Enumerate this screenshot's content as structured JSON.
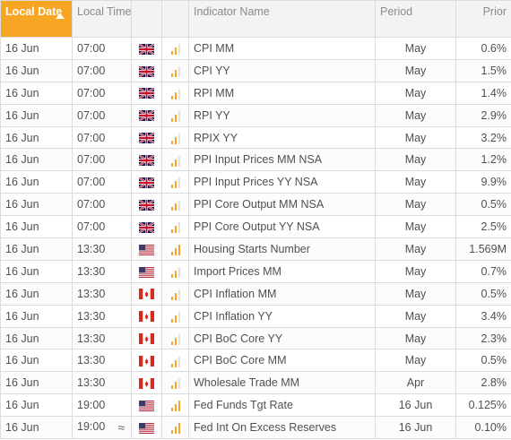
{
  "header": {
    "date_label": "Local Date",
    "time_label": "Local Time",
    "indicator_label": "Indicator Name",
    "period_label": "Period",
    "prior_label": "Prior"
  },
  "colors": {
    "accent": "#f7a623",
    "header_bg": "#f3f3f3",
    "border": "#dcdcdc"
  },
  "rows": [
    {
      "date": "16 Jun",
      "time": "07:00",
      "flag": "uk-flag-icon",
      "impact": "medium",
      "name": "CPI MM",
      "period": "May",
      "prior": "0.6%"
    },
    {
      "date": "16 Jun",
      "time": "07:00",
      "flag": "uk-flag-icon",
      "impact": "medium",
      "name": "CPI YY",
      "period": "May",
      "prior": "1.5%"
    },
    {
      "date": "16 Jun",
      "time": "07:00",
      "flag": "uk-flag-icon",
      "impact": "medium",
      "name": "RPI MM",
      "period": "May",
      "prior": "1.4%"
    },
    {
      "date": "16 Jun",
      "time": "07:00",
      "flag": "uk-flag-icon",
      "impact": "medium",
      "name": "RPI YY",
      "period": "May",
      "prior": "2.9%"
    },
    {
      "date": "16 Jun",
      "time": "07:00",
      "flag": "uk-flag-icon",
      "impact": "medium",
      "name": "RPIX YY",
      "period": "May",
      "prior": "3.2%"
    },
    {
      "date": "16 Jun",
      "time": "07:00",
      "flag": "uk-flag-icon",
      "impact": "medium",
      "name": "PPI Input Prices MM NSA",
      "period": "May",
      "prior": "1.2%"
    },
    {
      "date": "16 Jun",
      "time": "07:00",
      "flag": "uk-flag-icon",
      "impact": "medium",
      "name": "PPI Input Prices YY NSA",
      "period": "May",
      "prior": "9.9%"
    },
    {
      "date": "16 Jun",
      "time": "07:00",
      "flag": "uk-flag-icon",
      "impact": "medium",
      "name": "PPI Core Output MM NSA",
      "period": "May",
      "prior": "0.5%"
    },
    {
      "date": "16 Jun",
      "time": "07:00",
      "flag": "uk-flag-icon",
      "impact": "medium",
      "name": "PPI Core Output YY NSA",
      "period": "May",
      "prior": "2.5%"
    },
    {
      "date": "16 Jun",
      "time": "13:30",
      "flag": "us-flag-icon",
      "impact": "high",
      "name": "Housing Starts Number",
      "period": "May",
      "prior": "1.569M"
    },
    {
      "date": "16 Jun",
      "time": "13:30",
      "flag": "us-flag-icon",
      "impact": "medium",
      "name": "Import Prices MM",
      "period": "May",
      "prior": "0.7%"
    },
    {
      "date": "16 Jun",
      "time": "13:30",
      "flag": "ca-flag-icon",
      "impact": "medium",
      "name": "CPI Inflation MM",
      "period": "May",
      "prior": "0.5%"
    },
    {
      "date": "16 Jun",
      "time": "13:30",
      "flag": "ca-flag-icon",
      "impact": "medium",
      "name": "CPI Inflation YY",
      "period": "May",
      "prior": "3.4%"
    },
    {
      "date": "16 Jun",
      "time": "13:30",
      "flag": "ca-flag-icon",
      "impact": "medium",
      "name": "CPI BoC Core YY",
      "period": "May",
      "prior": "2.3%"
    },
    {
      "date": "16 Jun",
      "time": "13:30",
      "flag": "ca-flag-icon",
      "impact": "medium",
      "name": "CPI BoC Core MM",
      "period": "May",
      "prior": "0.5%"
    },
    {
      "date": "16 Jun",
      "time": "13:30",
      "flag": "ca-flag-icon",
      "impact": "medium",
      "name": "Wholesale Trade MM",
      "period": "Apr",
      "prior": "2.8%"
    },
    {
      "date": "16 Jun",
      "time": "19:00",
      "flag": "us-flag-icon",
      "impact": "high",
      "name": "Fed Funds Tgt Rate",
      "period": "16 Jun",
      "prior": "0.125%"
    },
    {
      "date": "16 Jun",
      "time": "19:00",
      "flag": "us-flag-icon",
      "impact": "high",
      "name": "Fed Int On Excess Reserves",
      "period": "16 Jun",
      "prior": "0.10%",
      "volatility": "≈"
    }
  ]
}
